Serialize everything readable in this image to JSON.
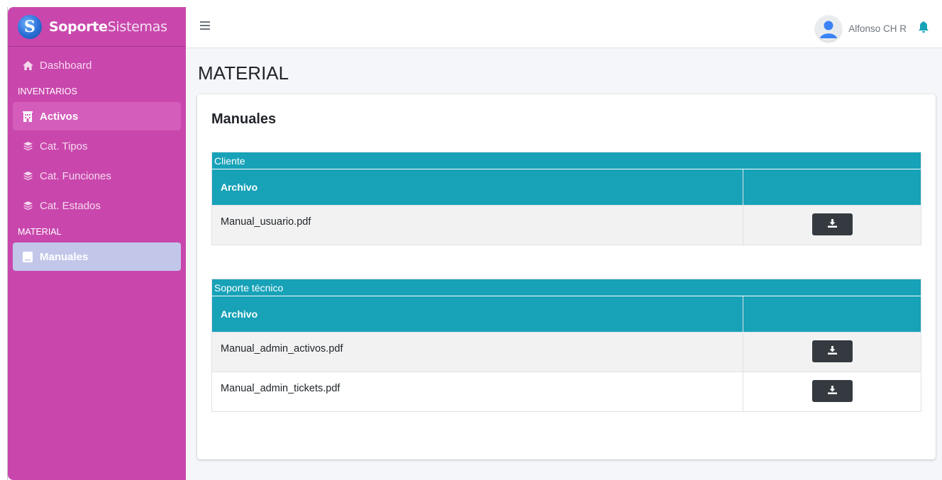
{
  "brand": {
    "name_bold": "Soporte",
    "name_light": "Sistemas",
    "logo_letter": "S"
  },
  "sidebar": {
    "items": [
      {
        "label": "Dashboard",
        "icon": "home-icon"
      },
      {
        "header": "INVENTARIOS"
      },
      {
        "label": "Activos",
        "icon": "building-icon",
        "state": "highlighted"
      },
      {
        "label": "Cat. Tipos",
        "icon": "layers-icon"
      },
      {
        "label": "Cat. Funciones",
        "icon": "layers-icon"
      },
      {
        "label": "Cat. Estados",
        "icon": "layers-icon"
      },
      {
        "header": "MATERIAL"
      },
      {
        "label": "Manuales",
        "icon": "book-icon",
        "state": "active"
      }
    ]
  },
  "topbar": {
    "user_name": "Alfonso CH R",
    "menu_icon": "hamburger-icon",
    "notification_icon": "bell-icon"
  },
  "page": {
    "title": "MATERIAL"
  },
  "card": {
    "title": "Manuales",
    "tables": [
      {
        "caption": "Cliente",
        "header": "Archivo",
        "rows": [
          {
            "file": "Manual_usuario.pdf"
          }
        ]
      },
      {
        "caption": "Soporte técnico",
        "header": "Archivo",
        "rows": [
          {
            "file": "Manual_admin_activos.pdf"
          },
          {
            "file": "Manual_admin_tickets.pdf"
          }
        ]
      }
    ]
  },
  "colors": {
    "sidebar_bg": "#c947ad",
    "table_header_bg": "#17a2b8",
    "download_button_bg": "#343a40",
    "active_item_bg": "#c2c7ea",
    "notification_icon": "#17a2b8"
  }
}
